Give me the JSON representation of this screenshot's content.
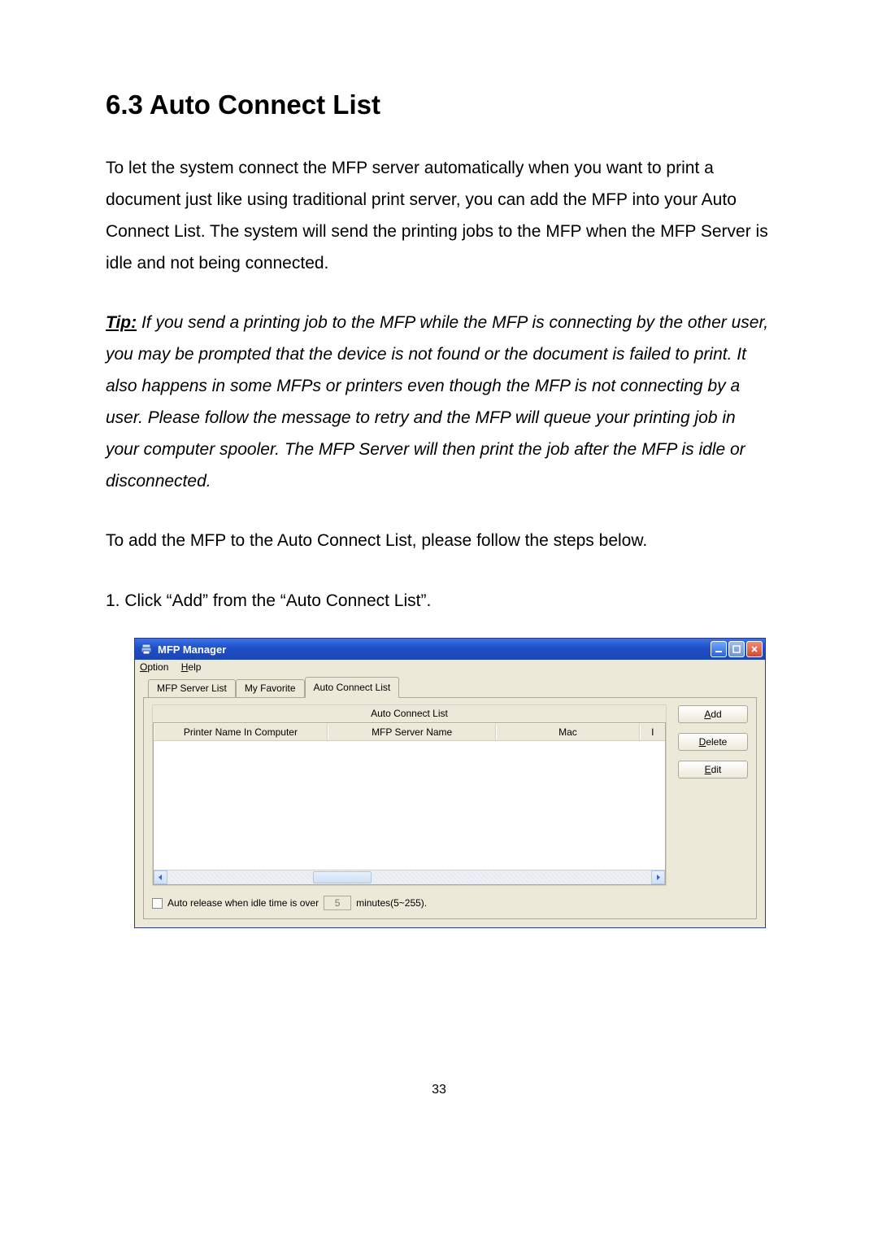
{
  "section": {
    "title": "6.3   Auto Connect List"
  },
  "paragraphs": {
    "intro": "To let the system connect the MFP server automatically when you want to print a document just like using traditional print server, you can add the MFP into your Auto Connect List. The system will send the printing jobs to the MFP when the MFP Server is idle and not being connected.",
    "tip_label": "Tip:",
    "tip_body": " If you send a printing job to the MFP while the MFP is connecting by the other user, you may be prompted that the device is not found or the document is failed to print. It also happens in some MFPs or printers even though the MFP is not connecting by a user. Please follow the message to retry and the MFP will queue your printing job in your computer spooler. The MFP Server will then print the job after the MFP is idle or disconnected.",
    "lead": "To add the MFP to the Auto Connect List, please follow the steps below.",
    "step1": "1.  Click “Add” from the “Auto Connect List”."
  },
  "window": {
    "title": "MFP Manager",
    "menus": {
      "option": {
        "hot": "O",
        "rest": "ption"
      },
      "help": {
        "hot": "H",
        "rest": "elp"
      }
    },
    "tabs": {
      "t1": "MFP Server List",
      "t2": "My Favorite",
      "t3": "Auto Connect List"
    },
    "group_caption": "Auto Connect List",
    "columns": {
      "c1": "Printer Name In Computer",
      "c2": "MFP Server Name",
      "c3": "Mac",
      "c4": "I"
    },
    "buttons": {
      "add": {
        "hot": "A",
        "rest": "dd"
      },
      "delete": {
        "hot": "D",
        "rest": "elete"
      },
      "edit": {
        "hot": "E",
        "rest": "dit"
      }
    },
    "bottom": {
      "label": "Auto release when idle time is over",
      "value": "5",
      "units": "minutes(5~255)."
    }
  },
  "page_number": "33"
}
